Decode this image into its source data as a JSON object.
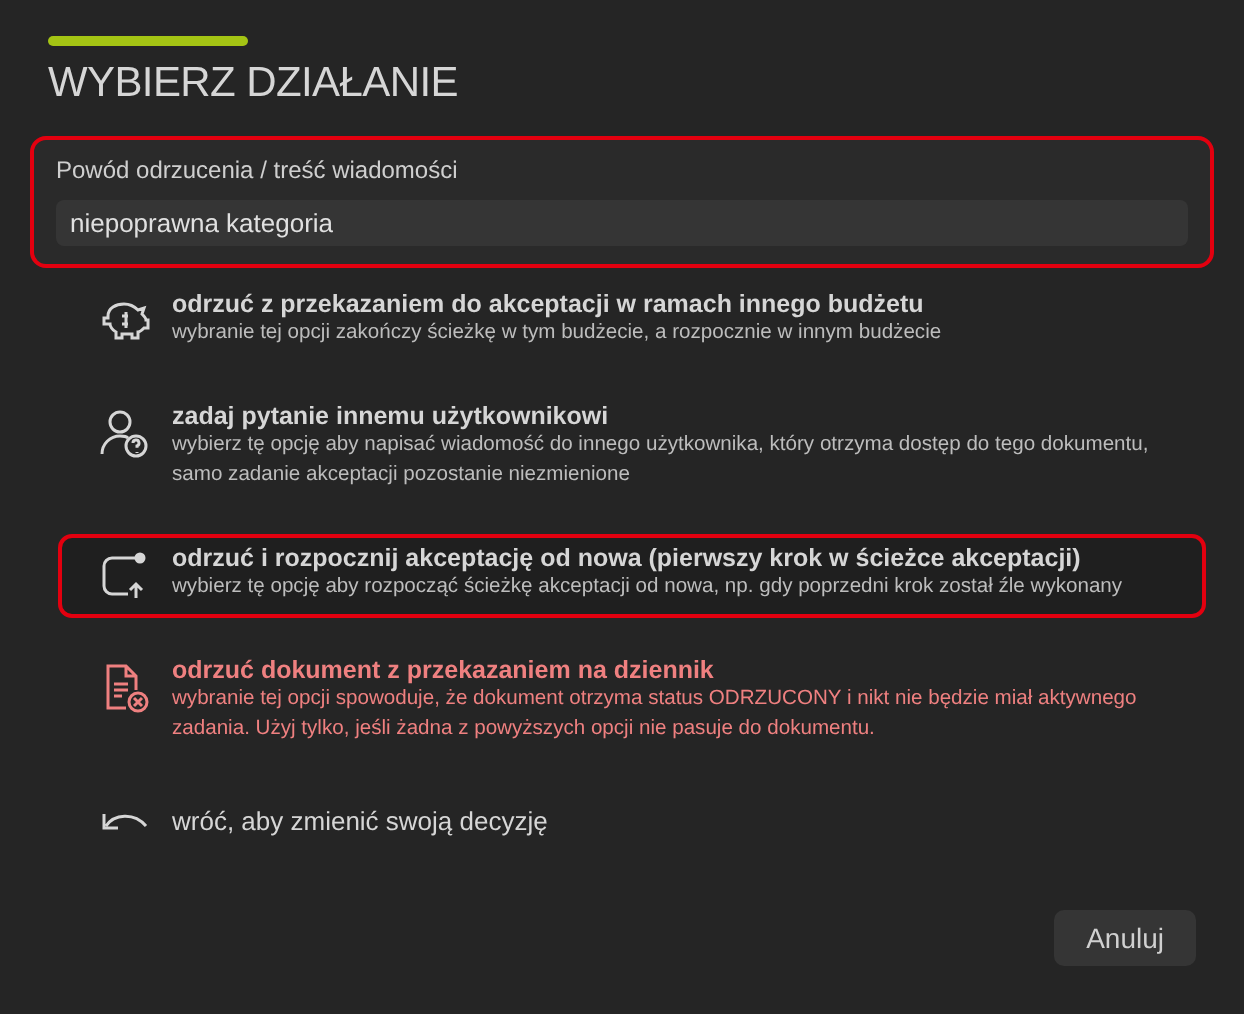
{
  "title": "WYBIERZ DZIAŁANIE",
  "reason": {
    "label": "Powód odrzucenia / treść wiadomości",
    "value": "niepoprawna kategoria",
    "highlighted": true
  },
  "options": [
    {
      "kind": "budget",
      "title": "odrzuć z przekazaniem do akceptacji w ramach innego budżetu",
      "description": "wybranie tej opcji zakończy ścieżkę w tym budżecie, a rozpocznie w innym budżecie",
      "highlighted": false,
      "danger": false
    },
    {
      "kind": "ask",
      "title": "zadaj pytanie innemu użytkownikowi",
      "description": "wybierz tę opcję aby napisać wiadomość do innego użytkownika, który otrzyma dostęp do tego dokumentu, samo zadanie akceptacji pozostanie niezmienione",
      "highlighted": false,
      "danger": false
    },
    {
      "kind": "restart",
      "title": "odrzuć i rozpocznij akceptację od nowa (pierwszy krok w ścieżce akceptacji)",
      "description": "wybierz tę opcję aby rozpocząć ścieżkę akceptacji od nowa, np. gdy poprzedni krok został źle wykonany",
      "highlighted": true,
      "danger": false
    },
    {
      "kind": "reject",
      "title": "odrzuć dokument z przekazaniem na dziennik",
      "description": "wybranie tej opcji spowoduje, że dokument otrzyma status ODRZUCONY i nikt nie będzie miał aktywnego zadania. Użyj tylko, jeśli żadna z powyższych opcji nie pasuje do dokumentu.",
      "highlighted": false,
      "danger": true
    },
    {
      "kind": "back",
      "title": "wróć, aby zmienić swoją decyzję",
      "highlighted": false,
      "danger": false
    }
  ],
  "buttons": [
    "Anuluj"
  ]
}
